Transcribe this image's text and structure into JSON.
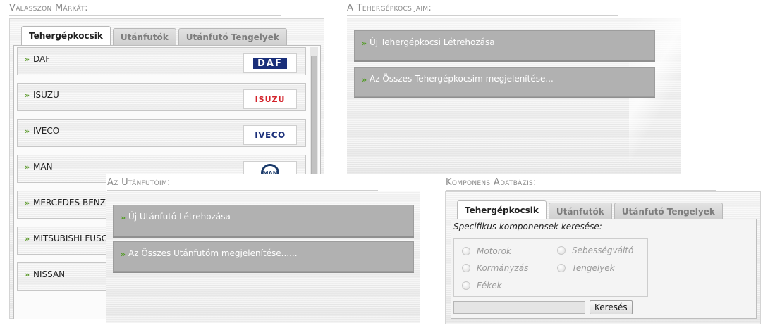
{
  "brand_panel": {
    "title": "Válasszon Márkát:",
    "tabs": [
      {
        "label": "Tehergépkocsik",
        "active": true
      },
      {
        "label": "Utánfutók",
        "active": false
      },
      {
        "label": "Utánfutó Tengelyek",
        "active": false
      }
    ],
    "arrow": "»",
    "brands": [
      {
        "name": "DAF",
        "logo_text": "DAF",
        "logo_color": "#1a2f7a"
      },
      {
        "name": "ISUZU",
        "logo_text": "ISUZU",
        "logo_color": "#d3222a"
      },
      {
        "name": "IVECO",
        "logo_text": "IVECO",
        "logo_color": "#1a2f7a"
      },
      {
        "name": "MAN",
        "logo_text": "MAN",
        "logo_color": "#1a3a6a"
      },
      {
        "name": "MERCEDES-BENZ",
        "logo_text": "",
        "logo_color": "#555555"
      },
      {
        "name": "MITSUBISHI FUSO",
        "logo_text": "",
        "logo_color": "#c0272d"
      },
      {
        "name": "NISSAN",
        "logo_text": "",
        "logo_color": "#444444"
      }
    ]
  },
  "trucks_panel": {
    "title": "A Tehergépkocsijaim:",
    "actions": [
      {
        "label": "Új Tehergépkocsi Létrehozása"
      },
      {
        "label": "Az Összes Tehergépkocsim megjelenítése..."
      }
    ]
  },
  "trailers_panel": {
    "title": "Az Utánfutóim:",
    "actions": [
      {
        "label": "Új Utánfutó Létrehozása"
      },
      {
        "label": "Az Összes Utánfutóm megjelenítése......"
      }
    ]
  },
  "components_panel": {
    "title": "Komponens Adatbázis:",
    "tabs": [
      {
        "label": "Tehergépkocsik",
        "active": true
      },
      {
        "label": "Utánfutók",
        "active": false
      },
      {
        "label": "Utánfutó Tengelyek",
        "active": false
      }
    ],
    "search_legend": "Specifikus komponensek keresése:",
    "options": [
      "Motorok",
      "Sebességváltó",
      "Kormányzás",
      "Tengelyek",
      "Fékek"
    ],
    "search_input_value": "",
    "search_button_label": "Keresés"
  },
  "colors": {
    "arrow_green": "#5b9a2a",
    "action_bg": "#b1b1b1",
    "title_gray": "#8a8a8a"
  }
}
